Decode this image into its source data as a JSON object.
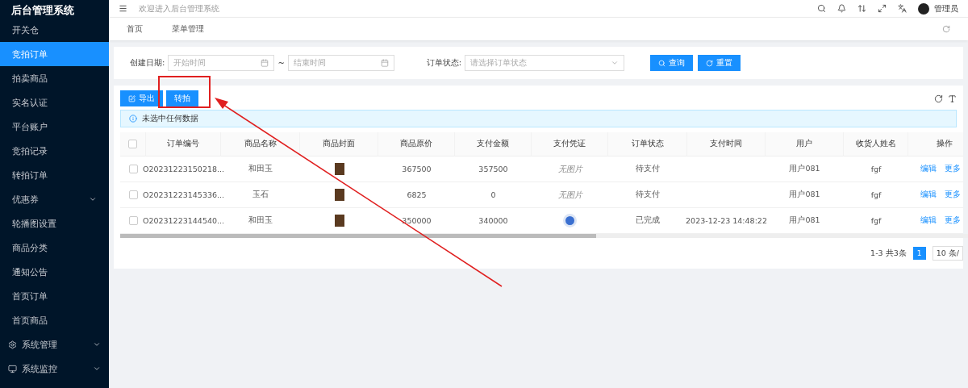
{
  "sidebar": {
    "title": "后台管理系统",
    "items": [
      {
        "label": "开关仓",
        "selected": false,
        "kind": "link"
      },
      {
        "label": "竞拍订单",
        "selected": true,
        "kind": "link"
      },
      {
        "label": "拍卖商品",
        "selected": false,
        "kind": "link"
      },
      {
        "label": "实名认证",
        "selected": false,
        "kind": "link"
      },
      {
        "label": "平台账户",
        "selected": false,
        "kind": "link"
      },
      {
        "label": "竞拍记录",
        "selected": false,
        "kind": "link"
      },
      {
        "label": "转拍订单",
        "selected": false,
        "kind": "link"
      },
      {
        "label": "优惠券",
        "selected": false,
        "kind": "group",
        "expanded": false
      },
      {
        "label": "轮播图设置",
        "selected": false,
        "kind": "link"
      },
      {
        "label": "商品分类",
        "selected": false,
        "kind": "link"
      },
      {
        "label": "通知公告",
        "selected": false,
        "kind": "link"
      },
      {
        "label": "首页订单",
        "selected": false,
        "kind": "link"
      },
      {
        "label": "首页商品",
        "selected": false,
        "kind": "link"
      },
      {
        "label": "系统管理",
        "selected": false,
        "kind": "settings",
        "expanded": false
      },
      {
        "label": "系统监控",
        "selected": false,
        "kind": "monitoring",
        "expanded": false
      }
    ]
  },
  "header": {
    "welcome": "欢迎进入后台管理系统",
    "user": "管理员"
  },
  "tabs": [
    {
      "label": "首页",
      "selected": false
    },
    {
      "label": "菜单管理",
      "selected": false
    }
  ],
  "filters": {
    "date_label": "创建日期:",
    "start_placeholder": "开始时间",
    "separator": "~",
    "end_placeholder": "结束时间",
    "status_label": "订单状态:",
    "status_placeholder": "请选择订单状态",
    "search_button": "查询",
    "reset_button": "重置"
  },
  "toolbar": {
    "export_button": "导出",
    "transfer_button": "转拍"
  },
  "alert": "未选中任何数据",
  "table": {
    "all_checked": false,
    "columns": [
      "订单编号",
      "商品名称",
      "商品封面",
      "商品原价",
      "支付金额",
      "支付凭证",
      "订单状态",
      "支付时间",
      "用户",
      "收货人姓名",
      "操作"
    ],
    "rows": [
      {
        "checked": false,
        "order_no": "O20231223150218...",
        "product": "和田玉",
        "price": "367500",
        "paid": "357500",
        "voucher": {
          "kind": "none",
          "text": "无图片"
        },
        "status": "待支付",
        "pay_time": "",
        "user": "用户081",
        "receiver": "fgf",
        "edit": "编辑",
        "more": "更多"
      },
      {
        "checked": false,
        "order_no": "O20231223145336...",
        "product": "玉石",
        "price": "6825",
        "paid": "0",
        "voucher": {
          "kind": "none",
          "text": "无图片"
        },
        "status": "待支付",
        "pay_time": "",
        "user": "用户081",
        "receiver": "fgf",
        "edit": "编辑",
        "more": "更多"
      },
      {
        "checked": false,
        "order_no": "O20231223144540...",
        "product": "和田玉",
        "price": "350000",
        "paid": "340000",
        "voucher": {
          "kind": "image"
        },
        "status": "已完成",
        "pay_time": "2023-12-23 14:48:22",
        "user": "用户081",
        "receiver": "fgf",
        "edit": "编辑",
        "more": "更多"
      }
    ]
  },
  "pagination": {
    "summary": "1-3 共3条",
    "pages": [
      {
        "label": "1",
        "selected": true
      }
    ],
    "page_size": "10 条/"
  }
}
